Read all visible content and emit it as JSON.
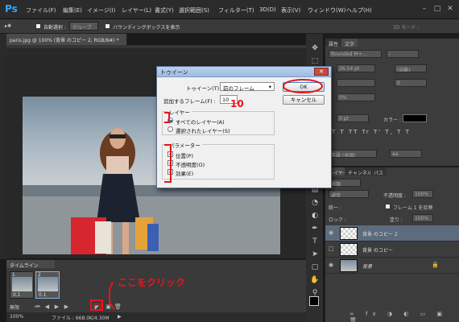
{
  "app": {
    "logo": "Ps",
    "menu": [
      "ファイル(F)",
      "編集(E)",
      "イメージ(I)",
      "レイヤー(L)",
      "書式(Y)",
      "選択範囲(S)",
      "フィルター(T)",
      "3D(D)",
      "表示(V)",
      "ウィンドウ(W)",
      "ヘルプ(H)"
    ],
    "window_buttons": [
      "–",
      "□",
      "✕"
    ]
  },
  "options_bar": {
    "auto_select": "自動選択 :",
    "group_value": "グループ",
    "bounding_box": "バウンディングボックスを表示",
    "mode_3d": "3D モード :"
  },
  "document": {
    "tab_label": "paris.jpg @ 100% (背景 のコピー 2, RGB/8#) *"
  },
  "dialog": {
    "title": "トゥイーン",
    "close": "✕",
    "tween_label": "トゥイーン(T) :",
    "tween_value": "前のフレーム",
    "frames_label": "追加するフレーム(F) :",
    "frames_value": "10",
    "ok": "OK",
    "cancel": "キャンセル",
    "layers_legend": "レイヤー",
    "all_layers": "すべてのレイヤー(A)",
    "selected_layers": "選択されたレイヤー(S)",
    "params_legend": "パラメーター",
    "position": "位置(P)",
    "opacity": "不透明度(O)",
    "effects": "効果(E)"
  },
  "annotations": {
    "ten": "10",
    "click_here": "ここをクリック"
  },
  "char_panel": {
    "tabs": [
      "属性",
      "文字"
    ],
    "font": "Rounded M+...",
    "size": "26.54 pt",
    "leading": "(自動)",
    "va": "0",
    "percent": "0%",
    "spacing": "0 pt",
    "color_label": "カラー :",
    "lang": "英語 (米国)",
    "aa": "aa"
  },
  "layers_panel": {
    "tabs": [
      "レイヤー",
      "チャンネル",
      "パス"
    ],
    "kind": "種類",
    "blend": "通常",
    "opacity_label": "不透明度 :",
    "opacity_value": "100%",
    "unify_label": "統一 :",
    "propagate": "フレーム 1 を反映",
    "lock_label": "ロック :",
    "fill_label": "塗り :",
    "fill_value": "100%",
    "layers": [
      {
        "name": "背景 のコピー 2"
      },
      {
        "name": "背景 のコピー"
      },
      {
        "name": "背景"
      }
    ]
  },
  "timeline": {
    "tab": "タイムライン",
    "frames": [
      {
        "num": "1",
        "delay": "0.1"
      },
      {
        "num": "2",
        "delay": "0.1"
      }
    ],
    "loop": "無限"
  },
  "status": {
    "zoom": "100%",
    "file": "ファイル : 668.0K/4.30M"
  },
  "colors": {
    "accent": "#31a8ff",
    "annotation_red": "#e8141a",
    "selected_layer": "#5d6b7e"
  }
}
